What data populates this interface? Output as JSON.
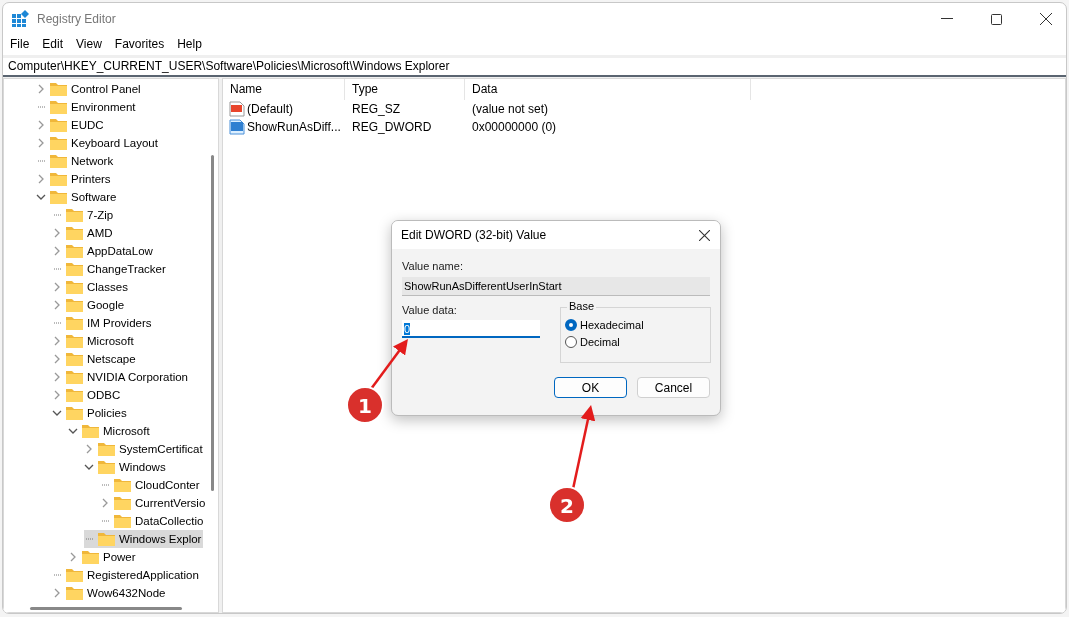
{
  "window": {
    "title": "Registry Editor"
  },
  "menu": [
    "File",
    "Edit",
    "View",
    "Favorites",
    "Help"
  ],
  "address": "Computer\\HKEY_CURRENT_USER\\Software\\Policies\\Microsoft\\Windows Explorer",
  "tree": [
    {
      "label": "Control Panel",
      "expandable": true,
      "expanded": false,
      "selected": false
    },
    {
      "label": "Environment",
      "expandable": false,
      "selected": false
    },
    {
      "label": "EUDC",
      "expandable": true,
      "expanded": false,
      "selected": false
    },
    {
      "label": "Keyboard Layout",
      "expandable": true,
      "expanded": false,
      "selected": false
    },
    {
      "label": "Network",
      "expandable": false,
      "selected": false
    },
    {
      "label": "Printers",
      "expandable": true,
      "expanded": false,
      "selected": false
    },
    {
      "label": "Software",
      "expandable": true,
      "expanded": true,
      "selected": false,
      "children": [
        {
          "label": "7-Zip",
          "expandable": false,
          "selected": false
        },
        {
          "label": "AMD",
          "expandable": true,
          "expanded": false,
          "selected": false
        },
        {
          "label": "AppDataLow",
          "expandable": true,
          "expanded": false,
          "selected": false
        },
        {
          "label": "ChangeTracker",
          "expandable": false,
          "selected": false
        },
        {
          "label": "Classes",
          "expandable": true,
          "expanded": false,
          "selected": false
        },
        {
          "label": "Google",
          "expandable": true,
          "expanded": false,
          "selected": false
        },
        {
          "label": "IM Providers",
          "expandable": false,
          "selected": false
        },
        {
          "label": "Microsoft",
          "expandable": true,
          "expanded": false,
          "selected": false
        },
        {
          "label": "Netscape",
          "expandable": true,
          "expanded": false,
          "selected": false
        },
        {
          "label": "NVIDIA Corporation",
          "expandable": true,
          "expanded": false,
          "selected": false
        },
        {
          "label": "ODBC",
          "expandable": true,
          "expanded": false,
          "selected": false
        },
        {
          "label": "Policies",
          "expandable": true,
          "expanded": true,
          "selected": false,
          "children": [
            {
              "label": "Microsoft",
              "expandable": true,
              "expanded": true,
              "selected": false,
              "children": [
                {
                  "label": "SystemCertificat",
                  "expandable": true,
                  "expanded": false,
                  "selected": false
                },
                {
                  "label": "Windows",
                  "expandable": true,
                  "expanded": true,
                  "selected": false,
                  "children": [
                    {
                      "label": "CloudConter",
                      "expandable": false,
                      "selected": false
                    },
                    {
                      "label": "CurrentVersio",
                      "expandable": true,
                      "expanded": false,
                      "selected": false
                    },
                    {
                      "label": "DataCollectio",
                      "expandable": false,
                      "selected": false
                    }
                  ]
                },
                {
                  "label": "Windows Explor",
                  "expandable": false,
                  "selected": true
                }
              ]
            },
            {
              "label": "Power",
              "expandable": true,
              "expanded": false,
              "selected": false
            }
          ]
        },
        {
          "label": "RegisteredApplication",
          "expandable": false,
          "selected": false
        },
        {
          "label": "Wow6432Node",
          "expandable": true,
          "expanded": false,
          "selected": false
        }
      ]
    }
  ],
  "values": {
    "columns": [
      "Name",
      "Type",
      "Data"
    ],
    "rows": [
      {
        "kind": "string",
        "name": "(Default)",
        "type": "REG_SZ",
        "data": "(value not set)"
      },
      {
        "kind": "binary",
        "name": "ShowRunAsDiff...",
        "type": "REG_DWORD",
        "data": "0x00000000 (0)"
      }
    ]
  },
  "dialog": {
    "title": "Edit DWORD (32-bit) Value",
    "value_name_label": "Value name:",
    "value_name": "ShowRunAsDifferentUserInStart",
    "value_data_label": "Value data:",
    "value_data": "0",
    "base_label": "Base",
    "base_options": [
      {
        "label": "Hexadecimal",
        "selected": true
      },
      {
        "label": "Decimal",
        "selected": false
      }
    ],
    "buttons": [
      {
        "label": "OK",
        "focused": true
      },
      {
        "label": "Cancel",
        "focused": false
      }
    ]
  },
  "annotations": [
    {
      "number": "1"
    },
    {
      "number": "2"
    }
  ]
}
